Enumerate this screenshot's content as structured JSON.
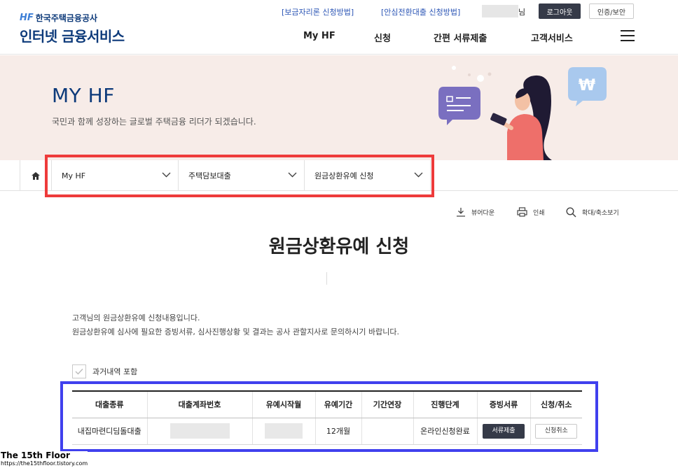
{
  "header": {
    "logo_org": "한국주택금융공사",
    "logo_mark": "HF",
    "logo_main": "인터넷 금융서비스",
    "util_links": [
      "[보금자리론 신청방법]",
      "[안심전환대출 신청방법]"
    ],
    "user_suffix": "님",
    "logout_label": "로그아웃",
    "auth_label": "인증/보안",
    "gnb": [
      "My HF",
      "신청",
      "간편 서류제출",
      "고객서비스"
    ]
  },
  "hero": {
    "title": "MY HF",
    "subtitle": "국민과 함께 성장하는 글로벌 주택금융 리더가 되겠습니다."
  },
  "breadcrumb": [
    "My HF",
    "주택담보대출",
    "원금상환유예 신청"
  ],
  "tools": [
    "뷰어다운",
    "인쇄",
    "확대/축소보기"
  ],
  "page_title": "원금상환유예 신청",
  "description": [
    "고객님의 원금상환유예 신청내용입니다.",
    "원금상환유예 심사에 필요한 증빙서류, 심사진행상황 및 결과는 공사 관할지사로 문의하시기 바랍니다."
  ],
  "include_history_label": "과거내역 포함",
  "table": {
    "headers": [
      "대출종류",
      "대출계좌번호",
      "유예시작월",
      "유예기간",
      "기간연장",
      "진행단계",
      "증빙서류",
      "신청/취소"
    ],
    "rows": [
      {
        "loan_type": "내집마련디딤돌대출",
        "period": "12개월",
        "extension": "",
        "status": "온라인신청완료",
        "doc_button": "서류제출",
        "cancel_button": "신청취소"
      }
    ]
  },
  "watermark": {
    "title": "The 15th Floor",
    "url": "https://the15thfloor.tistory.com"
  },
  "colors": {
    "brand_navy": "#0d3a7a",
    "hero_bg": "#f7ece8",
    "highlight_red": "#ee3b3b",
    "highlight_blue": "#4040ee",
    "button_dark": "#353a48"
  }
}
